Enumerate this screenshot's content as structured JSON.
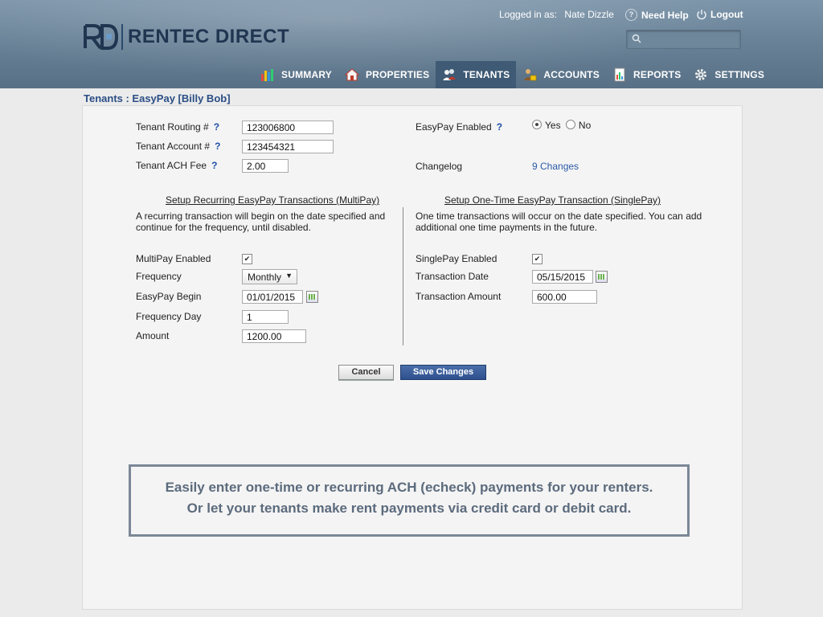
{
  "header": {
    "brand": "RENTEC DIRECT",
    "logged_in_label": "Logged in as:",
    "user_name": "Nate Dizzle",
    "help_label": "Need Help",
    "logout_label": "Logout",
    "search_placeholder": ""
  },
  "nav": [
    {
      "label": "SUMMARY",
      "icon": "bar-chart-icon",
      "active": false
    },
    {
      "label": "PROPERTIES",
      "icon": "house-icon",
      "active": false
    },
    {
      "label": "TENANTS",
      "icon": "people-icon",
      "active": true
    },
    {
      "label": "ACCOUNTS",
      "icon": "person-money-icon",
      "active": false
    },
    {
      "label": "REPORTS",
      "icon": "report-icon",
      "active": false
    },
    {
      "label": "SETTINGS",
      "icon": "gear-icon",
      "active": false
    }
  ],
  "breadcrumb": "Tenants : EasyPay [Billy Bob]",
  "form": {
    "routing_label": "Tenant Routing #",
    "routing_value": "123006800",
    "account_label": "Tenant Account #",
    "account_value": "123454321",
    "fee_label": "Tenant ACH Fee",
    "fee_value": "2.00",
    "help_mark": "?",
    "easypay_enabled_label": "EasyPay Enabled",
    "yes_label": "Yes",
    "no_label": "No",
    "easypay_enabled": "Yes",
    "changelog_label": "Changelog",
    "changelog_link": "9 Changes"
  },
  "multipay": {
    "title": "Setup Recurring EasyPay Transactions (MultiPay)",
    "desc_line1": "A recurring transaction will begin on the date specified and",
    "desc_line2": "continue for the frequency, until disabled.",
    "enabled_label": "MultiPay Enabled",
    "enabled": true,
    "frequency_label": "Frequency",
    "frequency_value": "Monthly",
    "begin_label": "EasyPay Begin",
    "begin_value": "01/01/2015",
    "freq_day_label": "Frequency Day",
    "freq_day_value": "1",
    "amount_label": "Amount",
    "amount_value": "1200.00"
  },
  "singlepay": {
    "title": "Setup One-Time EasyPay Transaction (SinglePay)",
    "desc_line1": "One time transactions will occur on the date specified. You can add",
    "desc_line2": "additional one time payments in the future.",
    "enabled_label": "SinglePay Enabled",
    "enabled": true,
    "date_label": "Transaction Date",
    "date_value": "05/15/2015",
    "amount_label": "Transaction Amount",
    "amount_value": "600.00"
  },
  "buttons": {
    "cancel": "Cancel",
    "save": "Save Changes"
  },
  "promo": {
    "line1": "Easily enter one-time or recurring ACH (echeck) payments for your renters.",
    "line2": "Or let your tenants make rent payments via credit card or debit card."
  },
  "colors": {
    "header": "#6b8499",
    "nav_active": "#3e5a74",
    "link": "#2b4e86",
    "save_button": "#2e5090"
  }
}
